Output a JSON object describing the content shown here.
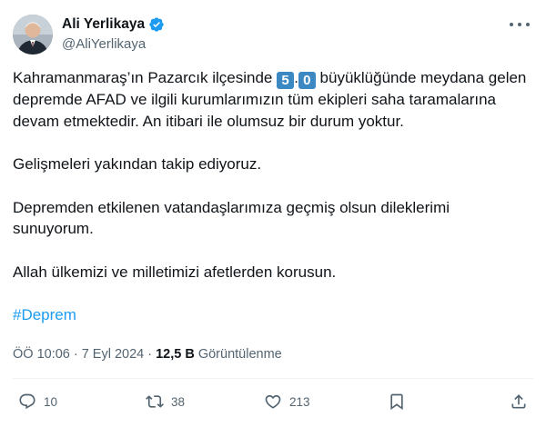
{
  "author": {
    "display_name": "Ali Yerlikaya",
    "handle": "@AliYerlikaya",
    "verified_color": "#1d9bf0"
  },
  "tweet": {
    "line1_prefix": "Kahramanmaraş’ın  Pazarcık ilçesinde ",
    "magnitude_digit1": "5",
    "magnitude_dot": ".",
    "magnitude_digit2": "0",
    "line1_suffix": " büyüklüğünde meydana gelen depremde AFAD ve ilgili kurumlarımızın tüm ekipleri saha taramalarına devam etmektedir. An itibari ile olumsuz bir durum yoktur.",
    "paragraph2": "Gelişmeleri yakından takip ediyoruz.",
    "paragraph3": "Depremden etkilenen vatandaşlarımıza geçmiş olsun dileklerimi sunuyorum.",
    "paragraph4": "Allah ülkemizi ve milletimizi afetlerden korusun.",
    "hashtag": "#Deprem"
  },
  "meta": {
    "time": "ÖÖ 10:06",
    "separator": "·",
    "date": "7 Eyl 2024",
    "views_count": "12,5 B",
    "views_label": "Görüntülenme"
  },
  "actions": {
    "replies": "10",
    "retweets": "38",
    "likes": "213"
  }
}
